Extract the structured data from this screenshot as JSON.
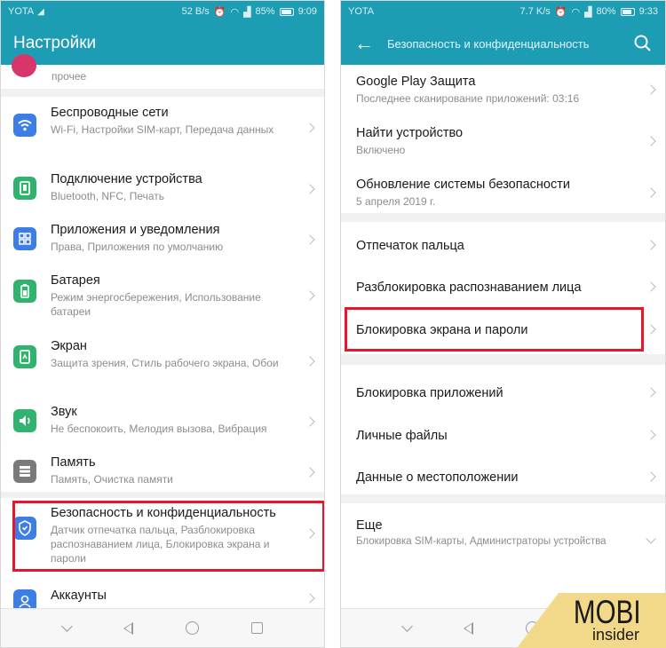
{
  "left": {
    "status": {
      "carrier": "YOTA",
      "speed": "52 B/s",
      "battery": "85%",
      "time": "9:09"
    },
    "title": "Настройки",
    "top_partial_text": "прочее",
    "items": [
      {
        "title": "Беспроводные сети",
        "subtitle": "Wi-Fi, Настройки SIM-карт, Передача данных",
        "icon": "wifi-icon",
        "color": "#3d7de6"
      },
      {
        "title": "Подключение устройства",
        "subtitle": "Bluetooth, NFC, Печать",
        "icon": "device-connection-icon",
        "color": "#2fb36e"
      },
      {
        "title": "Приложения и уведомления",
        "subtitle": "Права, Приложения по умолчанию",
        "icon": "apps-grid-icon",
        "color": "#3d7de6"
      },
      {
        "title": "Батарея",
        "subtitle": "Режим энергосбережения, Использование батареи",
        "icon": "battery-icon",
        "color": "#2fb36e"
      },
      {
        "title": "Экран",
        "subtitle": "Защита зрения, Стиль рабочего экрана, Обои",
        "icon": "display-icon",
        "color": "#2fb36e"
      },
      {
        "title": "Звук",
        "subtitle": "Не беспокоить, Мелодия вызова, Вибрация",
        "icon": "sound-icon",
        "color": "#2fb36e"
      },
      {
        "title": "Память",
        "subtitle": "Память, Очистка памяти",
        "icon": "storage-icon",
        "color": "#7a7a7a"
      },
      {
        "title": "Безопасность и конфиденциальность",
        "subtitle": "Датчик отпечатка пальца, Разблокировка распознаванием лица, Блокировка экрана и пароли",
        "icon": "shield-icon",
        "color": "#3d7de6"
      },
      {
        "title": "Аккаунты",
        "subtitle": "",
        "icon": "account-icon",
        "color": "#3d7de6"
      }
    ]
  },
  "right": {
    "status": {
      "carrier": "YOTA",
      "speed": "7.7 K/s",
      "battery": "80%",
      "time": "9:33"
    },
    "title": "Безопасность и конфиденциальность",
    "items": [
      {
        "title": "Google Play Защита",
        "subtitle": "Последнее сканирование приложений: 03:16"
      },
      {
        "title": "Найти устройство",
        "subtitle": "Включено"
      },
      {
        "title": "Обновление системы безопасности",
        "subtitle": "5 апреля 2019 г."
      },
      {
        "title": "Отпечаток пальца",
        "subtitle": ""
      },
      {
        "title": "Разблокировка распознаванием лица",
        "subtitle": ""
      },
      {
        "title": "Блокировка экрана и пароли",
        "subtitle": ""
      },
      {
        "title": "Блокировка приложений",
        "subtitle": ""
      },
      {
        "title": "Личные файлы",
        "subtitle": ""
      },
      {
        "title": "Данные о местоположении",
        "subtitle": ""
      },
      {
        "title": "Еще",
        "subtitle": "Блокировка SIM-карты, Администраторы устройства"
      }
    ]
  },
  "logo": {
    "brand": "MOBI",
    "tagline": "insider"
  },
  "colors": {
    "appbar": "#1d9db4",
    "highlight": "#e2182b"
  }
}
